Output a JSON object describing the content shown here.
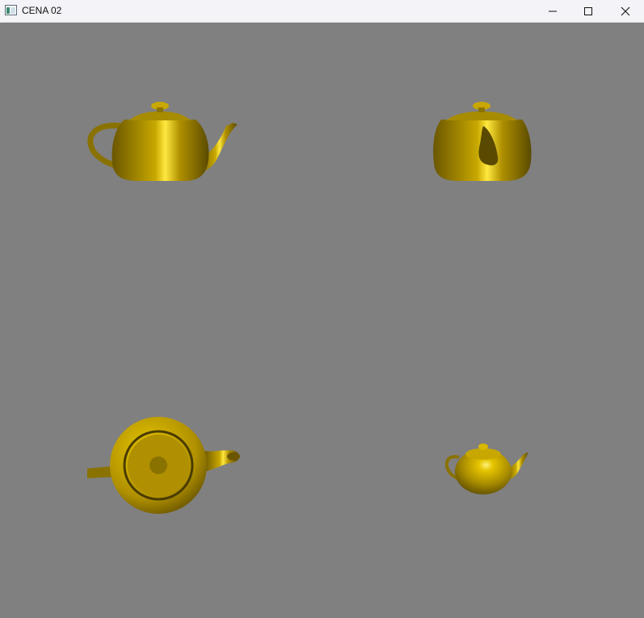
{
  "window": {
    "title": "CENA 02",
    "controls": [
      "minimize-icon",
      "maximize-icon",
      "close-icon"
    ]
  },
  "viewport": {
    "background_color": "#808080",
    "object_color": "#c8a800",
    "objects": [
      {
        "name": "teapot-side-view",
        "view": "side"
      },
      {
        "name": "teapot-front-view",
        "view": "front"
      },
      {
        "name": "teapot-top-view",
        "view": "top"
      },
      {
        "name": "teapot-small-perspective-view",
        "view": "perspective"
      }
    ]
  }
}
